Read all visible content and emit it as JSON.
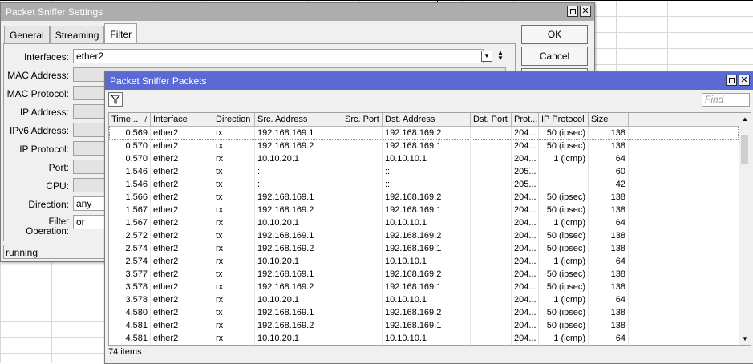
{
  "settings": {
    "title": "Packet Sniffer Settings",
    "tabs": [
      "General",
      "Streaming",
      "Filter"
    ],
    "active_tab": "Filter",
    "fields": [
      {
        "label": "Interfaces:",
        "value": "ether2"
      },
      {
        "label": "MAC Address:",
        "value": ""
      },
      {
        "label": "MAC Protocol:",
        "value": ""
      },
      {
        "label": "IP Address:",
        "value": ""
      },
      {
        "label": "IPv6 Address:",
        "value": ""
      },
      {
        "label": "IP Protocol:",
        "value": ""
      },
      {
        "label": "Port:",
        "value": ""
      },
      {
        "label": "CPU:",
        "value": ""
      },
      {
        "label": "Direction:",
        "value": "any"
      },
      {
        "label": "Filter Operation:",
        "value": "or"
      }
    ],
    "ok_label": "OK",
    "cancel_label": "Cancel",
    "status": "running"
  },
  "packets": {
    "title": "Packet Sniffer Packets",
    "find_placeholder": "Find",
    "columns": [
      "Time...",
      "Interface",
      "Direction",
      "Src. Address",
      "Src. Port",
      "Dst. Address",
      "Dst. Port",
      "Prot...",
      "IP Protocol",
      "Size"
    ],
    "rows": [
      [
        "0.569",
        "ether2",
        "tx",
        "192.168.169.1",
        "",
        "192.168.169.2",
        "",
        "204...",
        "50 (ipsec)",
        "138"
      ],
      [
        "0.570",
        "ether2",
        "rx",
        "192.168.169.2",
        "",
        "192.168.169.1",
        "",
        "204...",
        "50 (ipsec)",
        "138"
      ],
      [
        "0.570",
        "ether2",
        "rx",
        "10.10.20.1",
        "",
        "10.10.10.1",
        "",
        "204...",
        "1 (icmp)",
        "64"
      ],
      [
        "1.546",
        "ether2",
        "tx",
        "::",
        "",
        "::",
        "",
        "205...",
        "",
        "60"
      ],
      [
        "1.546",
        "ether2",
        "tx",
        "::",
        "",
        "::",
        "",
        "205...",
        "",
        "42"
      ],
      [
        "1.566",
        "ether2",
        "tx",
        "192.168.169.1",
        "",
        "192.168.169.2",
        "",
        "204...",
        "50 (ipsec)",
        "138"
      ],
      [
        "1.567",
        "ether2",
        "rx",
        "192.168.169.2",
        "",
        "192.168.169.1",
        "",
        "204...",
        "50 (ipsec)",
        "138"
      ],
      [
        "1.567",
        "ether2",
        "rx",
        "10.10.20.1",
        "",
        "10.10.10.1",
        "",
        "204...",
        "1 (icmp)",
        "64"
      ],
      [
        "2.572",
        "ether2",
        "tx",
        "192.168.169.1",
        "",
        "192.168.169.2",
        "",
        "204...",
        "50 (ipsec)",
        "138"
      ],
      [
        "2.574",
        "ether2",
        "rx",
        "192.168.169.2",
        "",
        "192.168.169.1",
        "",
        "204...",
        "50 (ipsec)",
        "138"
      ],
      [
        "2.574",
        "ether2",
        "rx",
        "10.10.20.1",
        "",
        "10.10.10.1",
        "",
        "204...",
        "1 (icmp)",
        "64"
      ],
      [
        "3.577",
        "ether2",
        "tx",
        "192.168.169.1",
        "",
        "192.168.169.2",
        "",
        "204...",
        "50 (ipsec)",
        "138"
      ],
      [
        "3.578",
        "ether2",
        "rx",
        "192.168.169.2",
        "",
        "192.168.169.1",
        "",
        "204...",
        "50 (ipsec)",
        "138"
      ],
      [
        "3.578",
        "ether2",
        "rx",
        "10.10.20.1",
        "",
        "10.10.10.1",
        "",
        "204...",
        "1 (icmp)",
        "64"
      ],
      [
        "4.580",
        "ether2",
        "tx",
        "192.168.169.1",
        "",
        "192.168.169.2",
        "",
        "204...",
        "50 (ipsec)",
        "138"
      ],
      [
        "4.581",
        "ether2",
        "rx",
        "192.168.169.2",
        "",
        "192.168.169.1",
        "",
        "204...",
        "50 (ipsec)",
        "138"
      ],
      [
        "4.581",
        "ether2",
        "rx",
        "10.10.20.1",
        "",
        "10.10.10.1",
        "",
        "204...",
        "1 (icmp)",
        "64"
      ]
    ],
    "count_label": "74 items"
  },
  "icons": {
    "filter": "funnel-icon",
    "maximize": "maximize-icon",
    "close": "close-icon"
  },
  "colors": {
    "packets_title_bg": "#5b6ad3",
    "settings_title_bg": "#adadad"
  }
}
